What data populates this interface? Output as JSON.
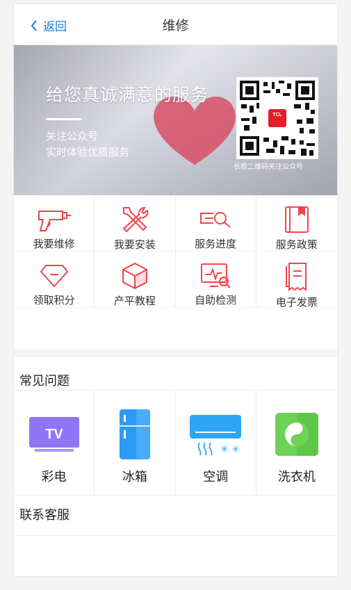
{
  "header": {
    "back_label": "返回",
    "title": "维修"
  },
  "banner": {
    "slogan": "给您真诚满意的服务",
    "line1": "关注公众号",
    "line2": "实时体验优质服务",
    "qr_caption": "长按二维码关注公众号",
    "qr_logo": "TCL"
  },
  "services": [
    {
      "label": "我要维修",
      "icon": "drill-icon"
    },
    {
      "label": "我要安装",
      "icon": "tools-icon"
    },
    {
      "label": "服务进度",
      "icon": "search-progress-icon"
    },
    {
      "label": "服务政策",
      "icon": "book-icon"
    },
    {
      "label": "领取积分",
      "icon": "diamond-icon"
    },
    {
      "label": "产平教程",
      "icon": "box-icon"
    },
    {
      "label": "自助检测",
      "icon": "monitor-check-icon"
    },
    {
      "label": "电子发票",
      "icon": "invoice-icon"
    }
  ],
  "faq": {
    "title": "常见问题",
    "categories": [
      {
        "label": "彩电",
        "icon": "tv-icon",
        "color": "#8f76f5"
      },
      {
        "label": "冰箱",
        "icon": "fridge-icon",
        "color": "#2b9bf5"
      },
      {
        "label": "空调",
        "icon": "air-conditioner-icon",
        "color": "#2ea5f5"
      },
      {
        "label": "洗衣机",
        "icon": "washer-icon",
        "color": "#5cc84a"
      }
    ]
  },
  "contact": {
    "label": "联系客服"
  },
  "colors": {
    "accent": "#1a7bd8",
    "icon_red": "#f0444a"
  }
}
